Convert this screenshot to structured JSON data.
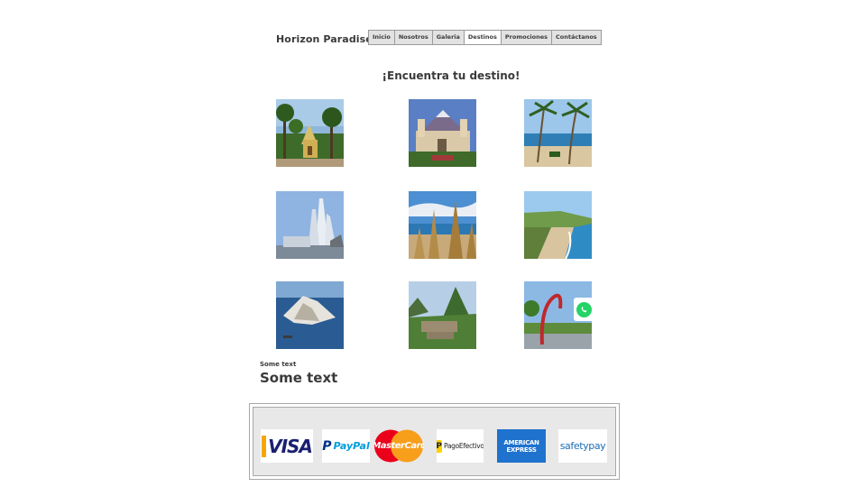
{
  "header": {
    "brand": "Horizon Paradise",
    "nav": [
      "Inicio",
      "Nosotros",
      "Galeria",
      "Destinos",
      "Promociones",
      "Contáctanos"
    ],
    "active_nav": "Destinos"
  },
  "main": {
    "headline": "¡Encuentra tu destino!",
    "destinations": [
      {
        "image": "tropical-plaza-church-photo"
      },
      {
        "image": "cathedral-volcano-photo"
      },
      {
        "image": "palm-beach-photo"
      },
      {
        "image": "white-sail-church-photo"
      },
      {
        "image": "reed-boats-beach-photo"
      },
      {
        "image": "coastal-cliff-beach-photo"
      },
      {
        "image": "island-aerial-photo"
      },
      {
        "image": "machu-picchu-photo"
      },
      {
        "image": "red-sculpture-park-photo"
      }
    ]
  },
  "floating": {
    "whatsapp_icon": "whatsapp-icon",
    "color": "#25d366"
  },
  "text": {
    "small": "Some text",
    "large": "Some text"
  },
  "payments": {
    "visa": "VISA",
    "paypal": "PayPal",
    "mastercard": "MasterCard",
    "pagoefectivo": "PagoEfectivo",
    "amex_line1": "AMERICAN",
    "amex_line2": "EXPRESS",
    "safetypay": "safetypay"
  },
  "colors": {
    "visa_blue": "#1a1f71",
    "visa_gold": "#f7a600",
    "paypal_dark": "#003087",
    "paypal_light": "#009cde",
    "mc_red": "#eb001b",
    "mc_orange": "#f79e1b",
    "amex_blue": "#1f72cd",
    "safetypay_blue": "#1b6fb5"
  }
}
